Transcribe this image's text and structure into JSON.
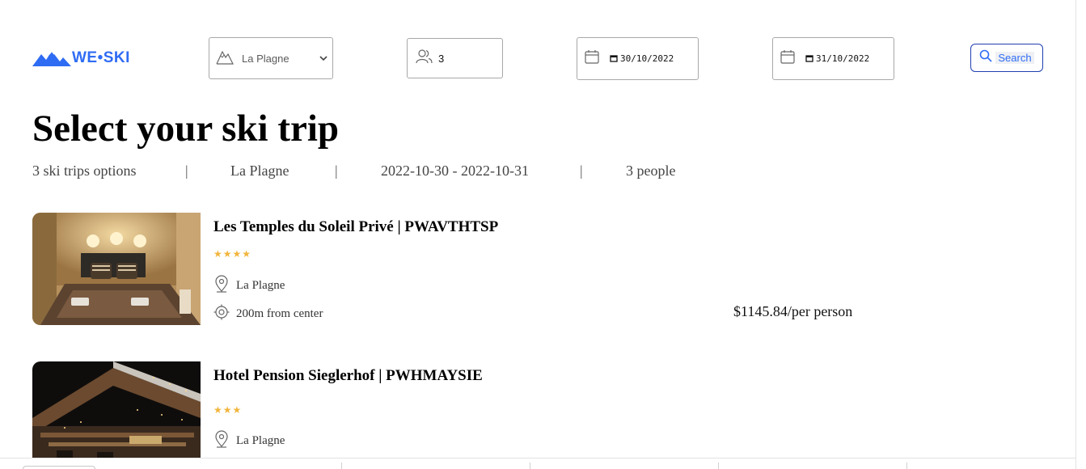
{
  "brand": {
    "name": "WE•SKI",
    "color": "#2f6cf4"
  },
  "search_form": {
    "resort": {
      "value": "La Plagne",
      "icon": "mountain-icon"
    },
    "people": {
      "value": "3",
      "icon": "people-icon"
    },
    "start_date": {
      "value": "30/10/2022",
      "icon": "calendar-icon"
    },
    "end_date": {
      "value": "31/10/2022",
      "icon": "calendar-icon"
    },
    "search_label": "Search"
  },
  "page_title": "Select your ski trip",
  "summary": {
    "options": "3 ski trips options",
    "separator": "|",
    "resort": "La Plagne",
    "dates": "2022-10-30 - 2022-10-31",
    "people": "3 people"
  },
  "hotels": [
    {
      "name": "Les Temples du Soleil Privé | PWAVTHTSP",
      "stars": 4,
      "location": "La Plagne",
      "distance": "200m from center",
      "price": "$1145.84/per person"
    },
    {
      "name": "Hotel Pension Sieglerhof | PWHMAYSIE",
      "stars": 3,
      "location": "La Plagne"
    }
  ],
  "colors": {
    "accent": "#2f6cf4",
    "star": "#f2b53c",
    "search_border": "#1f3fb0"
  }
}
